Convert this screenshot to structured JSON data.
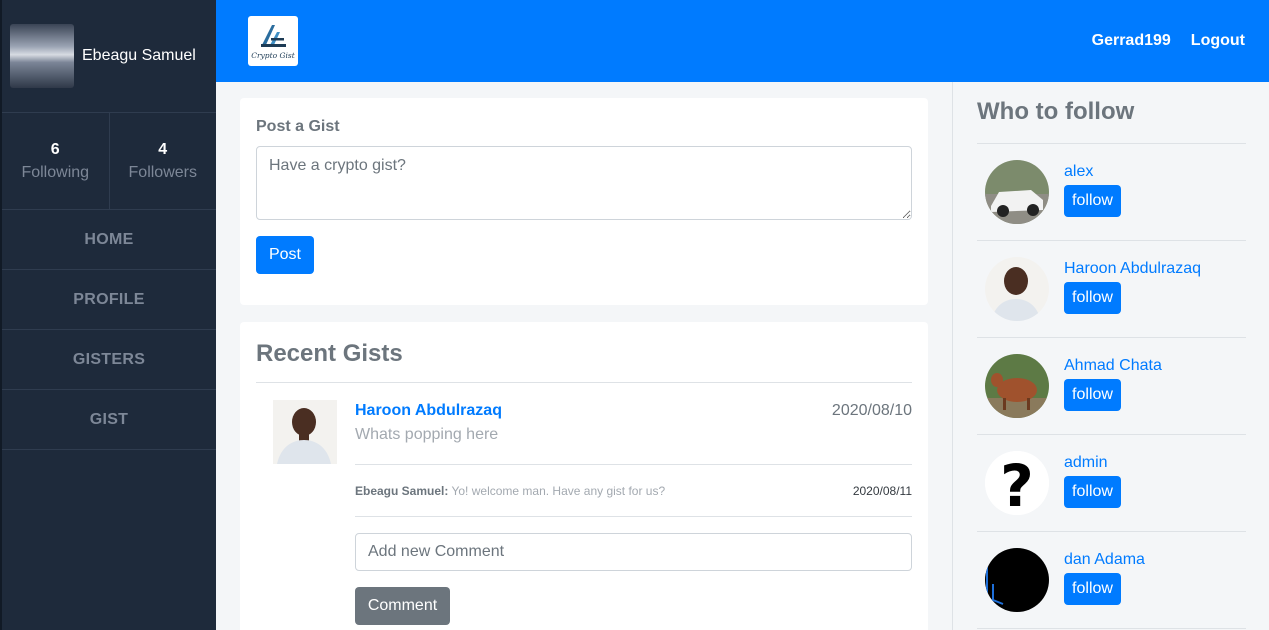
{
  "sidebar": {
    "user_name": "Ebeagu Samuel",
    "stats": [
      {
        "count": "6",
        "label": "Following"
      },
      {
        "count": "4",
        "label": "Followers"
      }
    ],
    "nav": [
      "HOME",
      "PROFILE",
      "GISTERS",
      "GIST"
    ]
  },
  "header": {
    "logo_text": "Crypto Gist",
    "username": "Gerrad199",
    "logout": "Logout"
  },
  "post": {
    "label": "Post a Gist",
    "placeholder": "Have a crypto gist?",
    "button": "Post"
  },
  "recent": {
    "title": "Recent Gists",
    "gists": [
      {
        "author": "Haroon Abdulrazaq",
        "date": "2020/08/10",
        "text": "Whats popping here",
        "comment": {
          "author": "Ebeagu Samuel:",
          "text": "Yo! welcome man. Have any gist for us?",
          "date": "2020/08/11"
        },
        "comment_placeholder": "Add new Comment",
        "comment_button": "Comment"
      }
    ]
  },
  "who_to_follow": {
    "title": "Who to follow",
    "button_label": "follow",
    "users": [
      {
        "name": "alex"
      },
      {
        "name": "Haroon Abdulrazaq"
      },
      {
        "name": "Ahmad Chata"
      },
      {
        "name": "admin"
      },
      {
        "name": "dan Adama"
      }
    ]
  },
  "colors": {
    "primary": "#007bff",
    "sidebar": "#1e2a3b",
    "secondary_button": "#6c757d"
  }
}
